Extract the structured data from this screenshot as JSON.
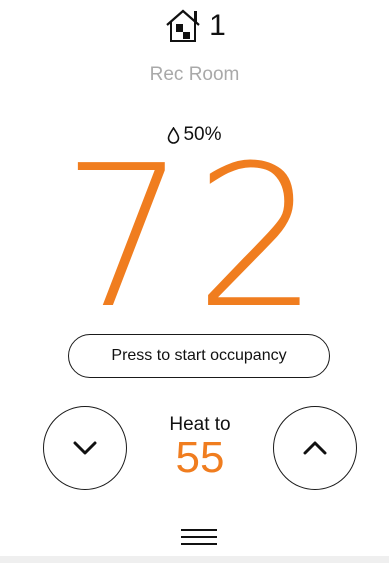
{
  "zone": {
    "number": "1",
    "icon": "zone-house-icon"
  },
  "room": {
    "name": "Rec Room"
  },
  "humidity": {
    "icon": "humidity-drop-icon",
    "value": "50%"
  },
  "temperature": {
    "current": "72"
  },
  "occupancy": {
    "button_label": "Press to start occupancy"
  },
  "setpoint": {
    "label": "Heat to",
    "value": "55",
    "decrease_icon": "chevron-down-icon",
    "increase_icon": "chevron-up-icon"
  },
  "menu": {
    "icon": "menu-icon"
  },
  "colors": {
    "accent": "#f07d1f",
    "muted_text": "#a9a9a9",
    "text": "#111111"
  }
}
